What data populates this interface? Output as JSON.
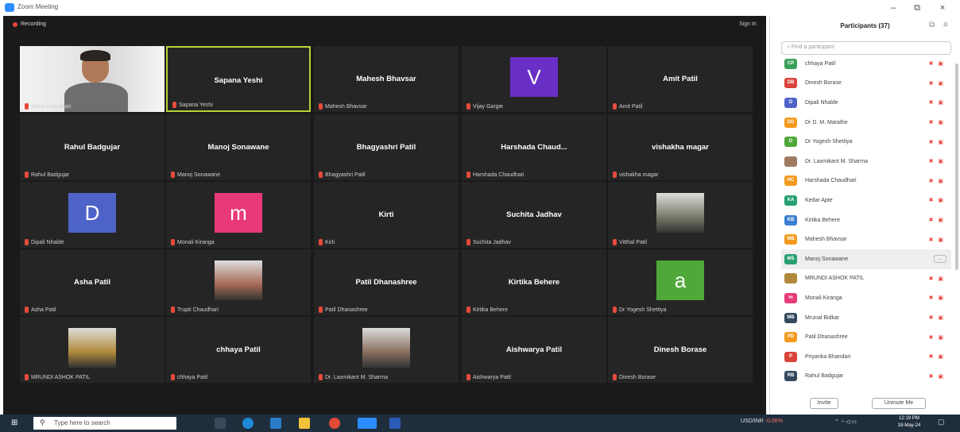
{
  "window": {
    "title": "Zoom Meeting",
    "minimize": "–",
    "maximize": "⧉",
    "close": "×"
  },
  "meeting": {
    "recording_label": "Recording",
    "sign_in_label": "Sign In"
  },
  "tiles": [
    {
      "name": "",
      "label": "vishal chaudhari",
      "kind": "camera"
    },
    {
      "name": "Sapana Yeshi",
      "label": "Sapana Yeshi",
      "kind": "name",
      "active": true
    },
    {
      "name": "Mahesh Bhavsar",
      "label": "Mahesh Bhavsar",
      "kind": "name"
    },
    {
      "name": "",
      "label": "Vijay Gargie",
      "kind": "avatar",
      "letter": "V",
      "color": "#6a2fc7"
    },
    {
      "name": "Amit Patil",
      "label": "Amit Patil",
      "kind": "name"
    },
    {
      "name": "Rahul Badgujar",
      "label": "Rahul Badgujar",
      "kind": "name"
    },
    {
      "name": "Manoj Sonawane",
      "label": "Manoj Sonawane",
      "kind": "name"
    },
    {
      "name": "Bhagyashri Patil",
      "label": "Bhagyashri Patil",
      "kind": "name"
    },
    {
      "name": "Harshada Chaud...",
      "label": "Harshada Chaudhari",
      "kind": "name"
    },
    {
      "name": "vishakha magar",
      "label": "vishakha magar",
      "kind": "name"
    },
    {
      "name": "",
      "label": "Dipali Nhalde",
      "kind": "avatar",
      "letter": "D",
      "color": "#4e63c8"
    },
    {
      "name": "",
      "label": "Monali Kiranga",
      "kind": "avatar",
      "letter": "m",
      "color": "#e83a78"
    },
    {
      "name": "Kirti",
      "label": "Kirti",
      "kind": "name"
    },
    {
      "name": "Suchita Jadhav",
      "label": "Suchita Jadhav",
      "kind": "name"
    },
    {
      "name": "",
      "label": "Vitthal Patil",
      "kind": "photo",
      "color": "#7a7a6a"
    },
    {
      "name": "Asha Patil",
      "label": "Asha Patil",
      "kind": "name"
    },
    {
      "name": "",
      "label": "Trupti Chaudhari",
      "kind": "photo",
      "color": "#a86a58"
    },
    {
      "name": "Patil Dhanashree",
      "label": "Patil Dhanashree",
      "kind": "name"
    },
    {
      "name": "Kirtika Behere",
      "label": "Kirtika Behere",
      "kind": "name"
    },
    {
      "name": "",
      "label": "Dr Yogesh Shettiya",
      "kind": "avatar",
      "letter": "a",
      "color": "#4fa838"
    },
    {
      "name": "",
      "label": "MRUNDI ASHOK PATIL",
      "kind": "photo",
      "color": "#b08a3a"
    },
    {
      "name": "chhaya Patil",
      "label": "chhaya Patil",
      "kind": "name"
    },
    {
      "name": "",
      "label": "Dr. Laxmikant M. Sharma",
      "kind": "photo",
      "color": "#8a7060"
    },
    {
      "name": "Aishwarya Patil",
      "label": "Aishwarya Patil",
      "kind": "name"
    },
    {
      "name": "Dinesh Borase",
      "label": "Dinesh Borase",
      "kind": "name"
    }
  ],
  "participants": {
    "title": "Participants (37)",
    "search_placeholder": "Find a participant",
    "list": [
      {
        "initials": "CP",
        "name": "chhaya Patil",
        "color": "#3aa05a"
      },
      {
        "initials": "DB",
        "name": "Dinesh Borase",
        "color": "#d8443a"
      },
      {
        "initials": "D",
        "name": "Dipali Nhalde",
        "color": "#4e63c8"
      },
      {
        "initials": "DD",
        "name": "Dr D. M. Marathe",
        "color": "#f39a1e"
      },
      {
        "initials": "D",
        "name": "Dr Yogesh Shettiya",
        "color": "#4fa838"
      },
      {
        "initials": "",
        "name": "Dr. Laxmikant M. Sharma",
        "color": "#a07a60"
      },
      {
        "initials": "HC",
        "name": "Harshada Chaudhari",
        "color": "#f39a1e"
      },
      {
        "initials": "KA",
        "name": "Kedar Apte",
        "color": "#27a070"
      },
      {
        "initials": "KB",
        "name": "Kirtika Behere",
        "color": "#3a7fd0"
      },
      {
        "initials": "MB",
        "name": "Mahesh Bhavsar",
        "color": "#f39a1e"
      },
      {
        "initials": "MS",
        "name": "Manoj Sonawane",
        "color": "#27a070",
        "highlight": true
      },
      {
        "initials": "",
        "name": "MRUNDI ASHOK PATIL",
        "color": "#b08a3a"
      },
      {
        "initials": "m",
        "name": "Monali Kiranga",
        "color": "#e83a78"
      },
      {
        "initials": "MB",
        "name": "Mrunal Bidkar",
        "color": "#34495e"
      },
      {
        "initials": "PD",
        "name": "Patil Dhanashree",
        "color": "#f39a1e"
      },
      {
        "initials": "P",
        "name": "Priyanka Bhandari",
        "color": "#d8443a"
      },
      {
        "initials": "RB",
        "name": "Rahul Badgujar",
        "color": "#34495e"
      }
    ],
    "invite_label": "Invite",
    "unmute_label": "Unmute Me",
    "more_label": "..."
  },
  "taskbar": {
    "search_placeholder": "Type here to search",
    "tray_text": "USD/INR",
    "tray_change": "-0.06%",
    "time": "12:19 PM",
    "date": "18-May-24"
  }
}
